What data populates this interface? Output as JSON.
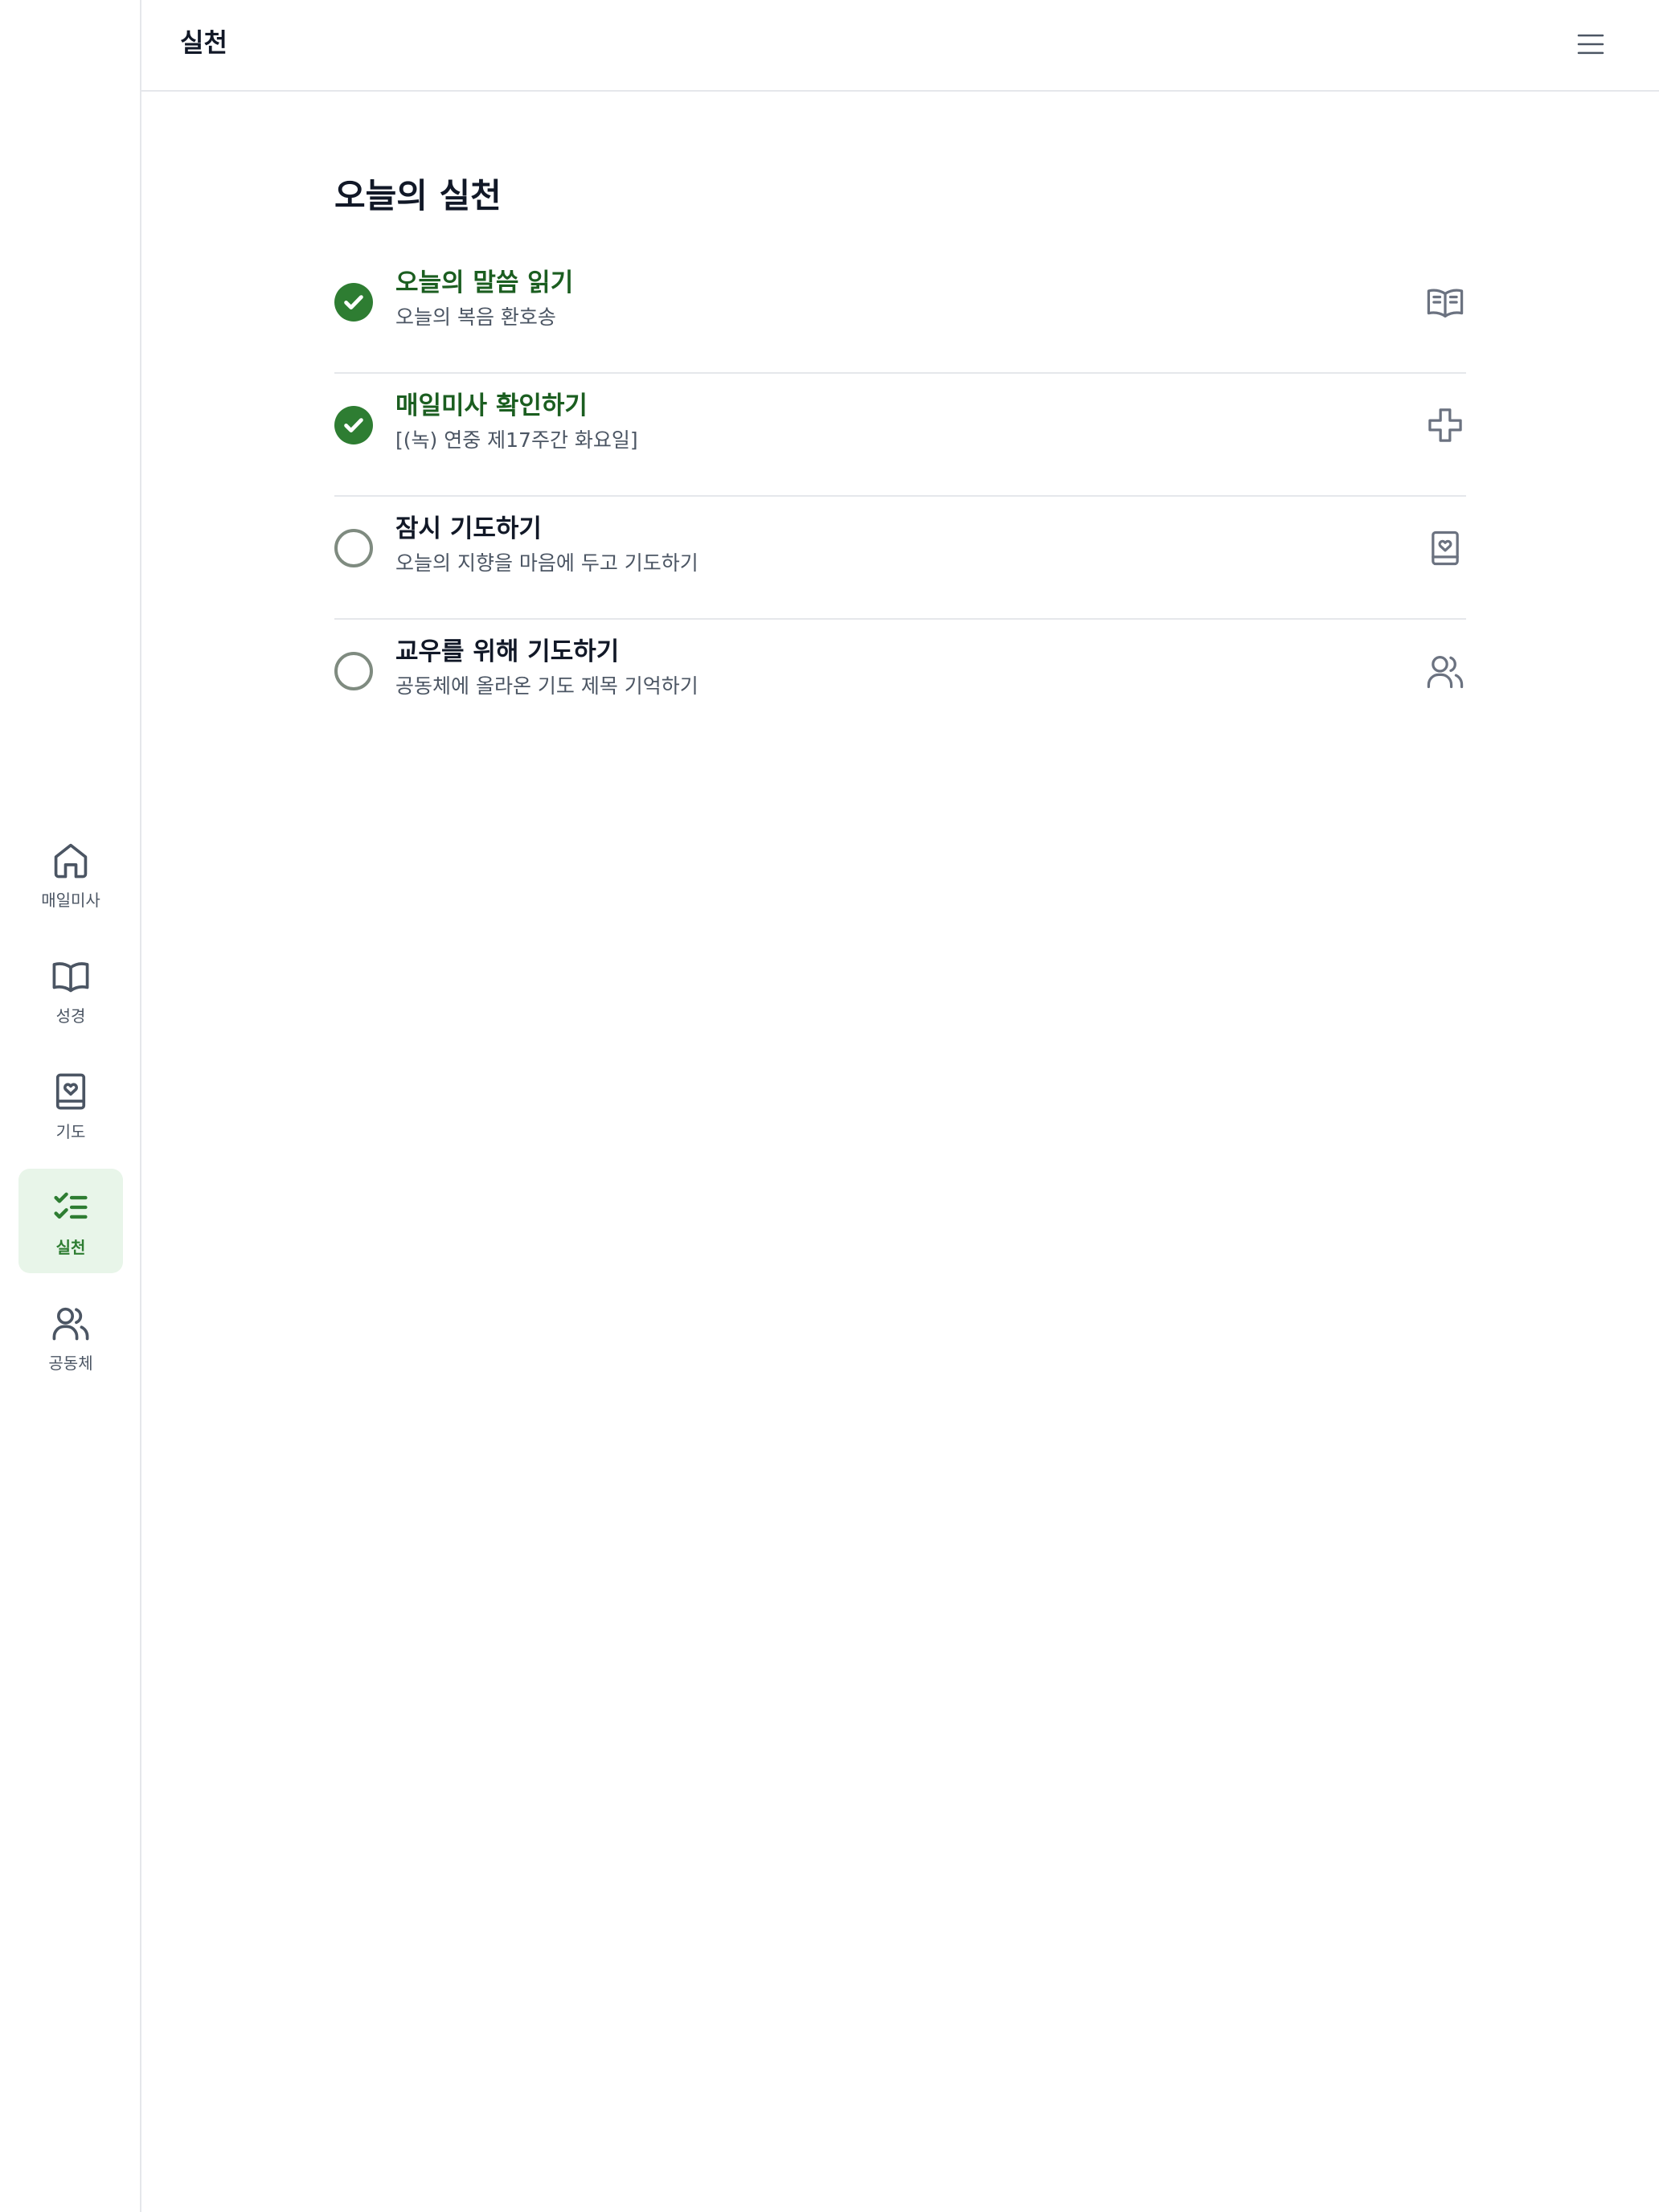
{
  "header": {
    "title": "실천",
    "menu_icon": "hamburger-menu-icon"
  },
  "nav": [
    {
      "label": "매일미사",
      "icon": "home-icon",
      "active": false
    },
    {
      "label": "성경",
      "icon": "open-book-icon",
      "active": false
    },
    {
      "label": "기도",
      "icon": "prayer-book-icon",
      "active": false
    },
    {
      "label": "실천",
      "icon": "checklist-icon",
      "active": true
    },
    {
      "label": "공동체",
      "icon": "users-icon",
      "active": false
    }
  ],
  "practice": {
    "title": "오늘의 실천",
    "tasks": [
      {
        "title": "오늘의 말씀 읽기",
        "subtitle": "오늘의 복음 환호송",
        "completed": true,
        "icon": "book-text-icon"
      },
      {
        "title": "매일미사 확인하기",
        "subtitle": "[(녹) 연중 제17주간 화요일]",
        "completed": true,
        "icon": "cross-icon"
      },
      {
        "title": "잠시 기도하기",
        "subtitle": "오늘의 지향을 마음에 두고 기도하기",
        "completed": false,
        "icon": "prayer-book-icon"
      },
      {
        "title": "교우를 위해 기도하기",
        "subtitle": "공동체에 올라온 기도 제목 기억하기",
        "completed": false,
        "icon": "users-icon"
      }
    ]
  },
  "colors": {
    "accent": "#2e7d32",
    "accent_dark": "#1b5e20",
    "active_nav_background": "#e8f5e9",
    "border": "#e5e7eb"
  }
}
